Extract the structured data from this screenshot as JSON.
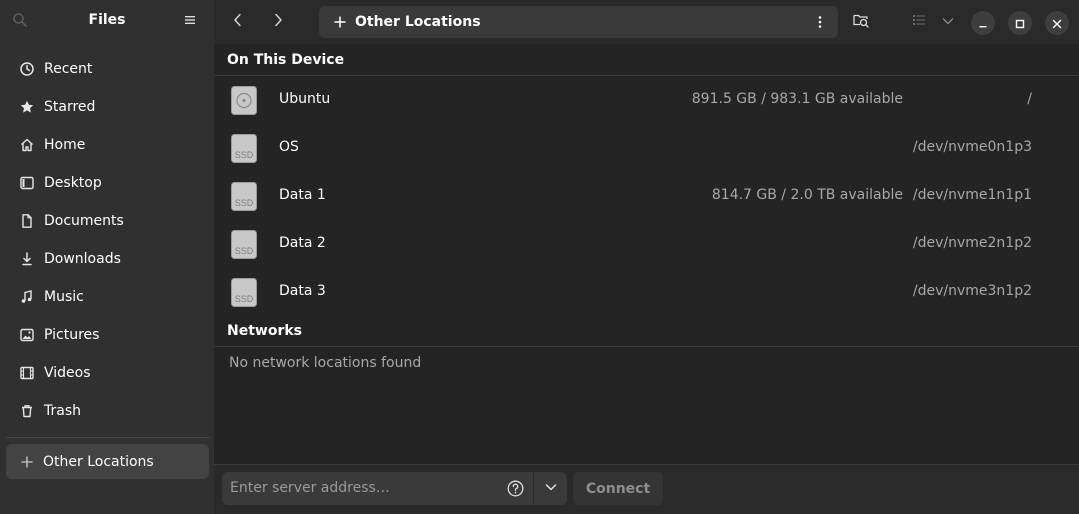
{
  "app": {
    "title": "Files"
  },
  "sidebar": {
    "items": [
      {
        "label": "Recent",
        "icon": "clock-icon"
      },
      {
        "label": "Starred",
        "icon": "star-icon"
      },
      {
        "label": "Home",
        "icon": "home-icon"
      },
      {
        "label": "Desktop",
        "icon": "desktop-icon"
      },
      {
        "label": "Documents",
        "icon": "document-icon"
      },
      {
        "label": "Downloads",
        "icon": "download-icon"
      },
      {
        "label": "Music",
        "icon": "music-icon"
      },
      {
        "label": "Pictures",
        "icon": "picture-icon"
      },
      {
        "label": "Videos",
        "icon": "video-icon"
      },
      {
        "label": "Trash",
        "icon": "trash-icon"
      }
    ],
    "other_locations": {
      "label": "Other Locations",
      "icon": "plus-icon",
      "selected": true
    }
  },
  "header": {
    "location": "Other Locations"
  },
  "sections": {
    "device_title": "On This Device",
    "networks_title": "Networks",
    "networks_empty": "No network locations found"
  },
  "devices": [
    {
      "name": "Ubuntu",
      "space": "891.5 GB / 983.1 GB available",
      "path": "/",
      "icon": "harddisk-icon"
    },
    {
      "name": "OS",
      "space": "",
      "path": "/dev/nvme0n1p3",
      "icon": "ssd-icon"
    },
    {
      "name": "Data 1",
      "space": "814.7 GB / 2.0 TB available",
      "path": "/dev/nvme1n1p1",
      "icon": "ssd-icon"
    },
    {
      "name": "Data 2",
      "space": "",
      "path": "/dev/nvme2n1p2",
      "icon": "ssd-icon"
    },
    {
      "name": "Data 3",
      "space": "",
      "path": "/dev/nvme3n1p2",
      "icon": "ssd-icon"
    }
  ],
  "ssd_badge": "SSD",
  "bottom": {
    "server_placeholder": "Enter server address…",
    "server_value": "",
    "connect_label": "Connect"
  },
  "colors": {
    "window_bg": "#242424",
    "sidebar_bg": "#303030",
    "selected_bg": "#434343",
    "dim_text": "#a8a8a8"
  }
}
